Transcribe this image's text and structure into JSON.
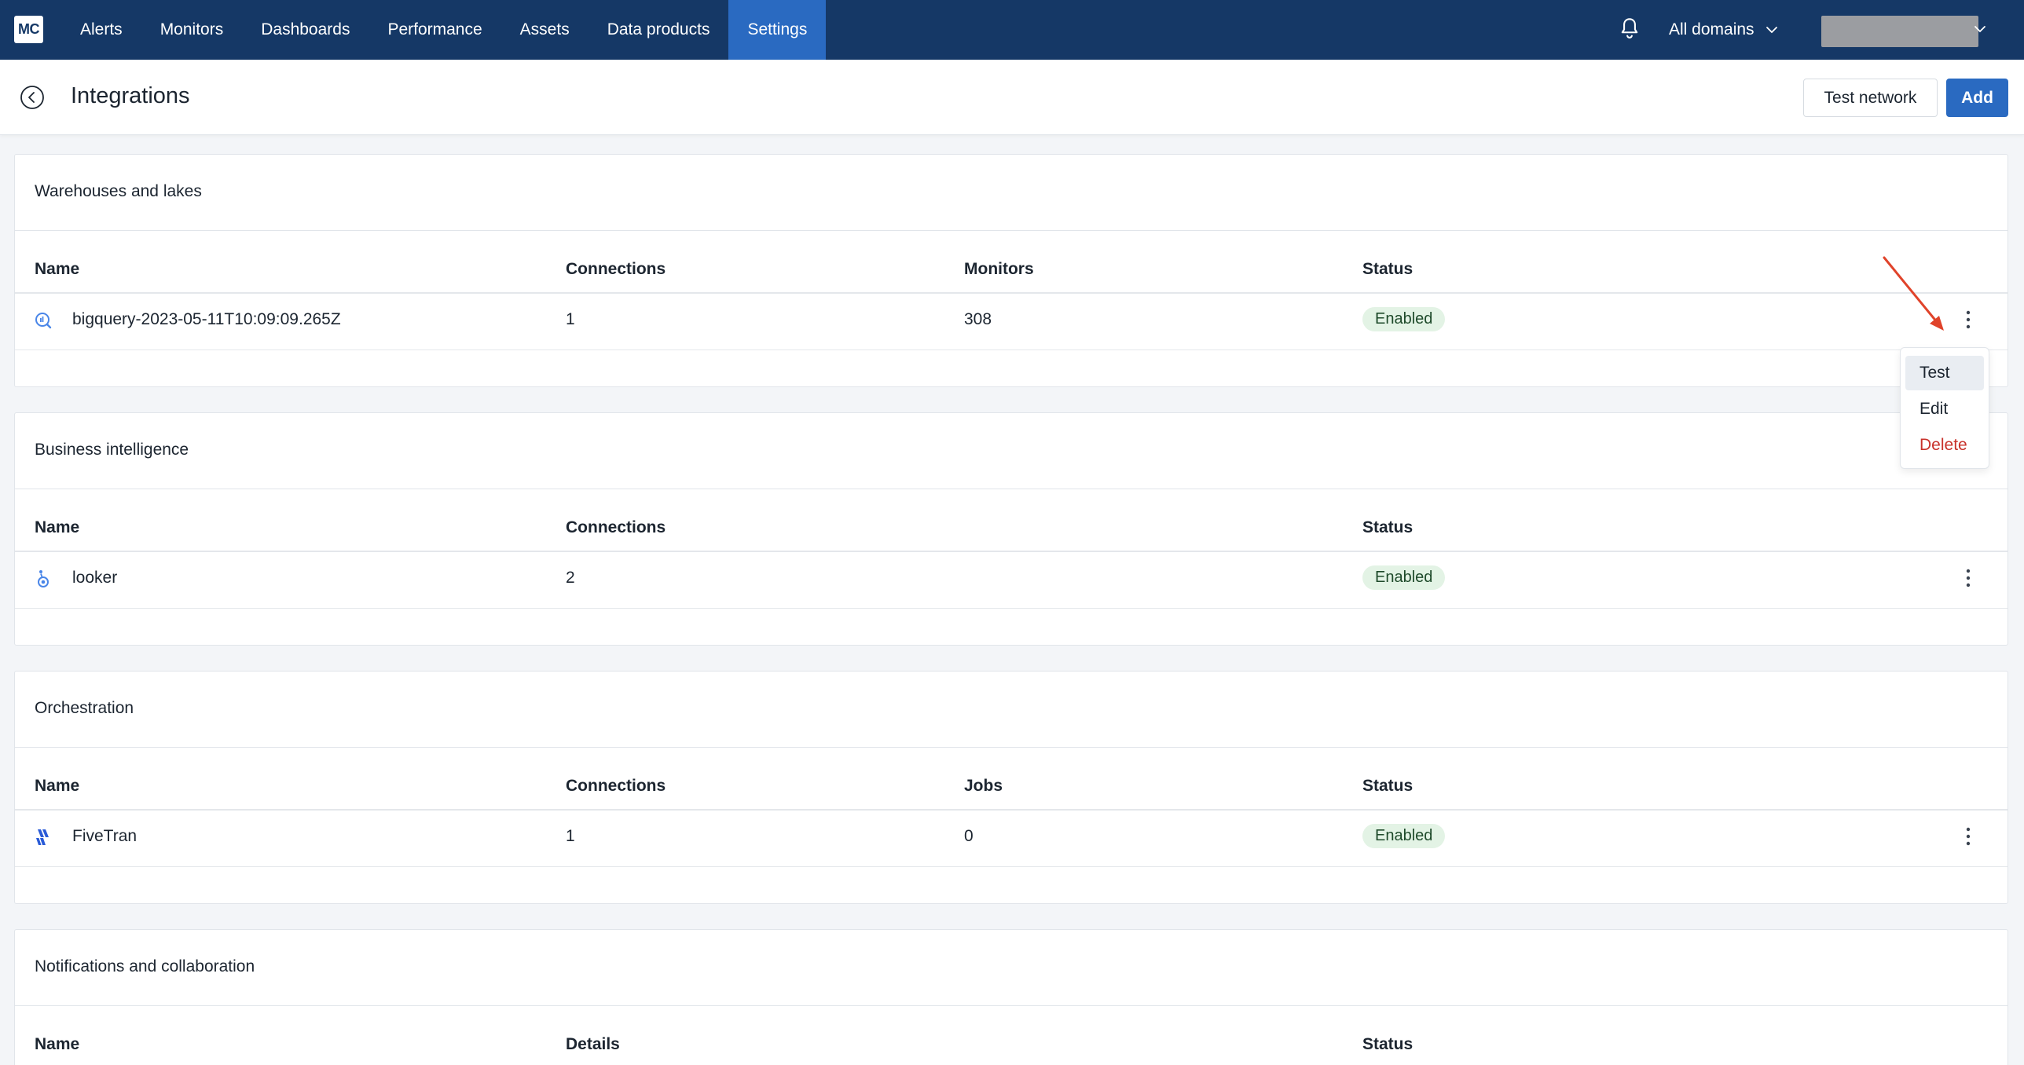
{
  "nav": {
    "logo": "MC",
    "items": [
      {
        "label": "Alerts"
      },
      {
        "label": "Monitors"
      },
      {
        "label": "Dashboards"
      },
      {
        "label": "Performance"
      },
      {
        "label": "Assets"
      },
      {
        "label": "Data products"
      },
      {
        "label": "Settings",
        "active": true
      }
    ],
    "domains_label": "All domains",
    "icons": {
      "bell": "bell-icon",
      "chevron": "chevron-down-icon"
    }
  },
  "header": {
    "title": "Integrations",
    "test_network_label": "Test network",
    "add_label": "Add",
    "back_icon": "back-circle-icon"
  },
  "sections": [
    {
      "title": "Warehouses and lakes",
      "columns": [
        "Name",
        "Connections",
        "Monitors",
        "Status"
      ],
      "rows": [
        {
          "icon": "bigquery-icon",
          "name": "bigquery-2023-05-11T10:09:09.265Z",
          "connections": "1",
          "monitors": "308",
          "status": "Enabled"
        }
      ]
    },
    {
      "title": "Business intelligence",
      "columns": [
        "Name",
        "Connections",
        "Status"
      ],
      "rows": [
        {
          "icon": "looker-icon",
          "name": "looker",
          "connections": "2",
          "status": "Enabled"
        }
      ]
    },
    {
      "title": "Orchestration",
      "columns": [
        "Name",
        "Connections",
        "Jobs",
        "Status"
      ],
      "rows": [
        {
          "icon": "fivetran-icon",
          "name": "FiveTran",
          "connections": "1",
          "jobs": "0",
          "status": "Enabled"
        }
      ]
    },
    {
      "title": "Notifications and collaboration",
      "columns": [
        "Name",
        "Details",
        "Status"
      ]
    }
  ],
  "row_menu": {
    "items": [
      {
        "label": "Test"
      },
      {
        "label": "Edit"
      },
      {
        "label": "Delete"
      }
    ]
  },
  "colors": {
    "nav_bg": "#153866",
    "nav_active": "#2a6ac1",
    "primary": "#2a6ac1",
    "badge_bg": "#e3f3e5",
    "danger": "#c8322b",
    "annotation": "#e0432a"
  }
}
